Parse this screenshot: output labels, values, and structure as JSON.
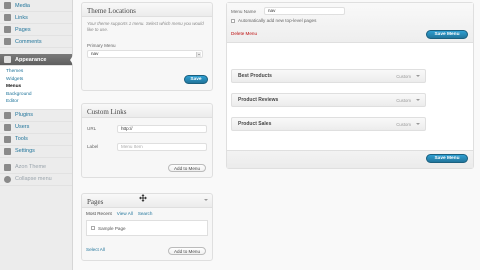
{
  "sidebar": {
    "menu": [
      {
        "label": "Media",
        "icon": "media-icon"
      },
      {
        "label": "Links",
        "icon": "links-icon"
      },
      {
        "label": "Pages",
        "icon": "pages-icon"
      },
      {
        "label": "Comments",
        "icon": "comments-icon"
      }
    ],
    "appearance": {
      "label": "Appearance",
      "icon": "appearance-icon"
    },
    "appearance_sub": [
      "Themes",
      "Widgets",
      "Menus",
      "Background",
      "Editor"
    ],
    "menu2": [
      {
        "label": "Plugins",
        "icon": "plugins-icon"
      },
      {
        "label": "Users",
        "icon": "users-icon"
      },
      {
        "label": "Tools",
        "icon": "tools-icon"
      },
      {
        "label": "Settings",
        "icon": "settings-icon"
      }
    ],
    "azon": {
      "label": "Azon Theme",
      "icon": "azon-icon"
    },
    "collapse": {
      "label": "Collapse menu",
      "icon": "collapse-icon"
    }
  },
  "theme_locations": {
    "title": "Theme Locations",
    "note": "Your theme supports 1 menu. Select which menu you would like to use.",
    "primary_label": "Primary Menu",
    "primary_value": "nav",
    "save_label": "Save"
  },
  "custom_links": {
    "title": "Custom Links",
    "url_label": "URL",
    "url_value": "http://",
    "label_label": "Label",
    "label_placeholder": "Menu Item",
    "add_label": "Add to Menu"
  },
  "pages": {
    "title": "Pages",
    "tabs": [
      "Most Recent",
      "View All",
      "Search"
    ],
    "item": "Sample Page",
    "select_all": "Select All",
    "add_label": "Add to Menu"
  },
  "menu_editor": {
    "name_label": "Menu Name",
    "name_value": "nav",
    "auto_add": "Automatically add new top-level pages",
    "delete_label": "Delete Menu",
    "save_label": "Save Menu",
    "items": [
      {
        "label": "Best Products",
        "type": "Custom"
      },
      {
        "label": "Product Reviews",
        "type": "Custom"
      },
      {
        "label": "Product Sales",
        "type": "Custom"
      }
    ]
  }
}
